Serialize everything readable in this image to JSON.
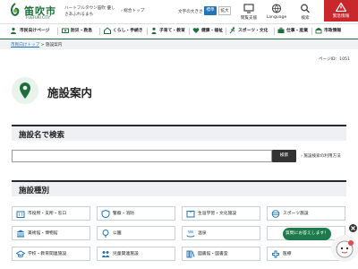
{
  "header": {
    "logo_text": "笛吹市",
    "logo_sub": "FUEFUKI CITY",
    "catchphrase": "ハートフルタウン笛吹 優しさあふれるまち",
    "general_top_link": "総合トップ",
    "font_size_label": "文字の大きさ",
    "font_standard": "標準",
    "font_large": "拡大",
    "reading_support": "閲覧支援",
    "language": "Language",
    "search": "検索",
    "disaster_info": "緊急情報"
  },
  "nav": {
    "items": [
      "市民向けページ",
      "防災・救急",
      "くらし・手続き",
      "子育て・教育",
      "健康・福祉",
      "スポーツ・文化",
      "仕事・産業",
      "市政情報"
    ]
  },
  "breadcrumb": {
    "home": "市民向けトップ",
    "sep": ">",
    "current": "施設案内"
  },
  "page_id": "ページID：1051",
  "title": "施設案内",
  "search_section": {
    "heading": "施設名で検索",
    "input_value": "",
    "button": "検索",
    "help_link": "施設検索の利用方法"
  },
  "category_section": {
    "heading": "施設種別",
    "items": [
      "市役所・支所・窓口",
      "警察・消防",
      "生涯学習・文化施設",
      "スポーツ施設",
      "美術館・博物館",
      "公園",
      "温泉",
      "",
      "学校・教育関連施設",
      "児童関連施設",
      "図書館・図書室",
      "医療"
    ]
  },
  "chat": {
    "label": "質問にお答えします！"
  },
  "colors": {
    "brand_green": "#1e6f3c",
    "accent_blue": "#1f73b7",
    "alert_red": "#c8282c"
  }
}
